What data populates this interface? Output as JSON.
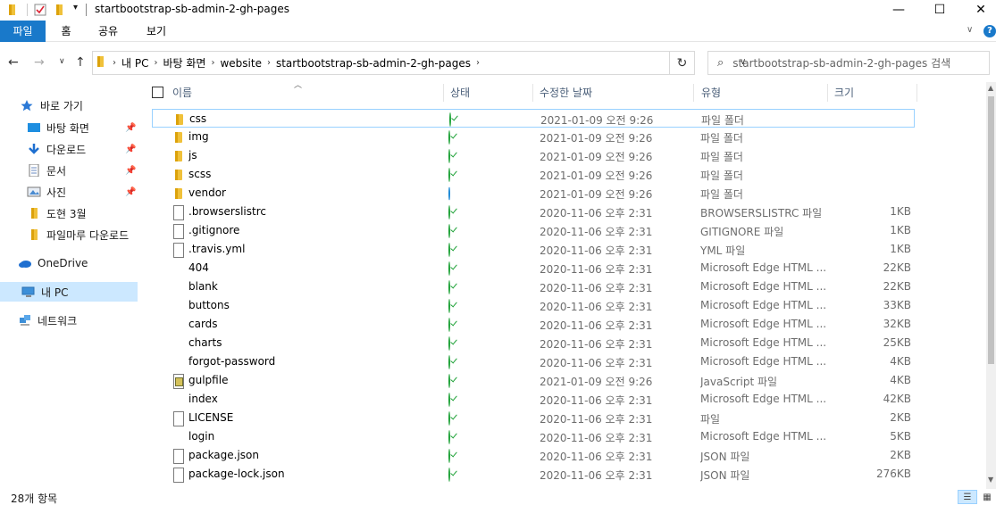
{
  "window": {
    "title": "startbootstrap-sb-admin-2-gh-pages",
    "minimize": "—",
    "maximize": "☐",
    "close": "✕"
  },
  "ribbon": {
    "tabs": [
      "파일",
      "홈",
      "공유",
      "보기"
    ],
    "help": "?"
  },
  "address": {
    "crumbs": [
      "내 PC",
      "바탕 화면",
      "website",
      "startbootstrap-sb-admin-2-gh-pages"
    ],
    "search_placeholder": "startbootstrap-sb-admin-2-gh-pages 검색"
  },
  "sidebar": {
    "items": [
      {
        "label": "바로 가기",
        "icon": "star-icon"
      },
      {
        "label": "바탕 화면",
        "icon": "desktop-icon",
        "pinned": true
      },
      {
        "label": "다운로드",
        "icon": "download-icon",
        "pinned": true
      },
      {
        "label": "문서",
        "icon": "document-icon",
        "pinned": true
      },
      {
        "label": "사진",
        "icon": "picture-icon",
        "pinned": true
      },
      {
        "label": "도현 3월",
        "icon": "folder-icon"
      },
      {
        "label": "파일마루 다운로드",
        "icon": "folder-icon"
      },
      {
        "label": "OneDrive",
        "icon": "cloud-icon"
      },
      {
        "label": "내 PC",
        "icon": "computer-icon",
        "selected": true
      },
      {
        "label": "네트워크",
        "icon": "network-icon"
      }
    ]
  },
  "columns": {
    "name": "이름",
    "status": "상태",
    "modified": "수정한 날짜",
    "type": "유형",
    "size": "크기"
  },
  "files": [
    {
      "name": "css",
      "icon": "folder",
      "status": "ok",
      "date": "2021-01-09 오전 9:26",
      "type": "파일 폴더",
      "size": "",
      "focused": true
    },
    {
      "name": "img",
      "icon": "folder",
      "status": "ok",
      "date": "2021-01-09 오전 9:26",
      "type": "파일 폴더",
      "size": ""
    },
    {
      "name": "js",
      "icon": "folder",
      "status": "ok",
      "date": "2021-01-09 오전 9:26",
      "type": "파일 폴더",
      "size": ""
    },
    {
      "name": "scss",
      "icon": "folder",
      "status": "ok",
      "date": "2021-01-09 오전 9:26",
      "type": "파일 폴더",
      "size": ""
    },
    {
      "name": "vendor",
      "icon": "folder",
      "status": "sync",
      "date": "2021-01-09 오전 9:26",
      "type": "파일 폴더",
      "size": ""
    },
    {
      "name": ".browserslistrc",
      "icon": "file",
      "status": "ok",
      "date": "2020-11-06 오후 2:31",
      "type": "BROWSERSLISTRC 파일",
      "size": "1KB"
    },
    {
      "name": ".gitignore",
      "icon": "file",
      "status": "ok",
      "date": "2020-11-06 오후 2:31",
      "type": "GITIGNORE 파일",
      "size": "1KB"
    },
    {
      "name": ".travis.yml",
      "icon": "file",
      "status": "ok",
      "date": "2020-11-06 오후 2:31",
      "type": "YML 파일",
      "size": "1KB"
    },
    {
      "name": "404",
      "icon": "edge",
      "status": "ok",
      "date": "2020-11-06 오후 2:31",
      "type": "Microsoft Edge HTML ...",
      "size": "22KB"
    },
    {
      "name": "blank",
      "icon": "edge",
      "status": "ok",
      "date": "2020-11-06 오후 2:31",
      "type": "Microsoft Edge HTML ...",
      "size": "22KB"
    },
    {
      "name": "buttons",
      "icon": "edge",
      "status": "ok",
      "date": "2020-11-06 오후 2:31",
      "type": "Microsoft Edge HTML ...",
      "size": "33KB"
    },
    {
      "name": "cards",
      "icon": "edge",
      "status": "ok",
      "date": "2020-11-06 오후 2:31",
      "type": "Microsoft Edge HTML ...",
      "size": "32KB"
    },
    {
      "name": "charts",
      "icon": "edge",
      "status": "ok",
      "date": "2020-11-06 오후 2:31",
      "type": "Microsoft Edge HTML ...",
      "size": "25KB"
    },
    {
      "name": "forgot-password",
      "icon": "edge",
      "status": "ok",
      "date": "2020-11-06 오후 2:31",
      "type": "Microsoft Edge HTML ...",
      "size": "4KB"
    },
    {
      "name": "gulpfile",
      "icon": "js",
      "status": "ok",
      "date": "2021-01-09 오전 9:26",
      "type": "JavaScript 파일",
      "size": "4KB"
    },
    {
      "name": "index",
      "icon": "edge",
      "status": "ok",
      "date": "2020-11-06 오후 2:31",
      "type": "Microsoft Edge HTML ...",
      "size": "42KB"
    },
    {
      "name": "LICENSE",
      "icon": "file",
      "status": "ok",
      "date": "2020-11-06 오후 2:31",
      "type": "파일",
      "size": "2KB"
    },
    {
      "name": "login",
      "icon": "edge",
      "status": "ok",
      "date": "2020-11-06 오후 2:31",
      "type": "Microsoft Edge HTML ...",
      "size": "5KB"
    },
    {
      "name": "package.json",
      "icon": "file",
      "status": "ok",
      "date": "2020-11-06 오후 2:31",
      "type": "JSON 파일",
      "size": "2KB"
    },
    {
      "name": "package-lock.json",
      "icon": "file",
      "status": "ok",
      "date": "2020-11-06 오후 2:31",
      "type": "JSON 파일",
      "size": "276KB"
    }
  ],
  "status": {
    "item_count": "28개 항목"
  },
  "colors": {
    "accent": "#1979ca",
    "selection": "#cce8ff",
    "focus_border": "#99d1ff",
    "ok_green": "#21a33a",
    "sync_blue": "#1f8ad6"
  }
}
